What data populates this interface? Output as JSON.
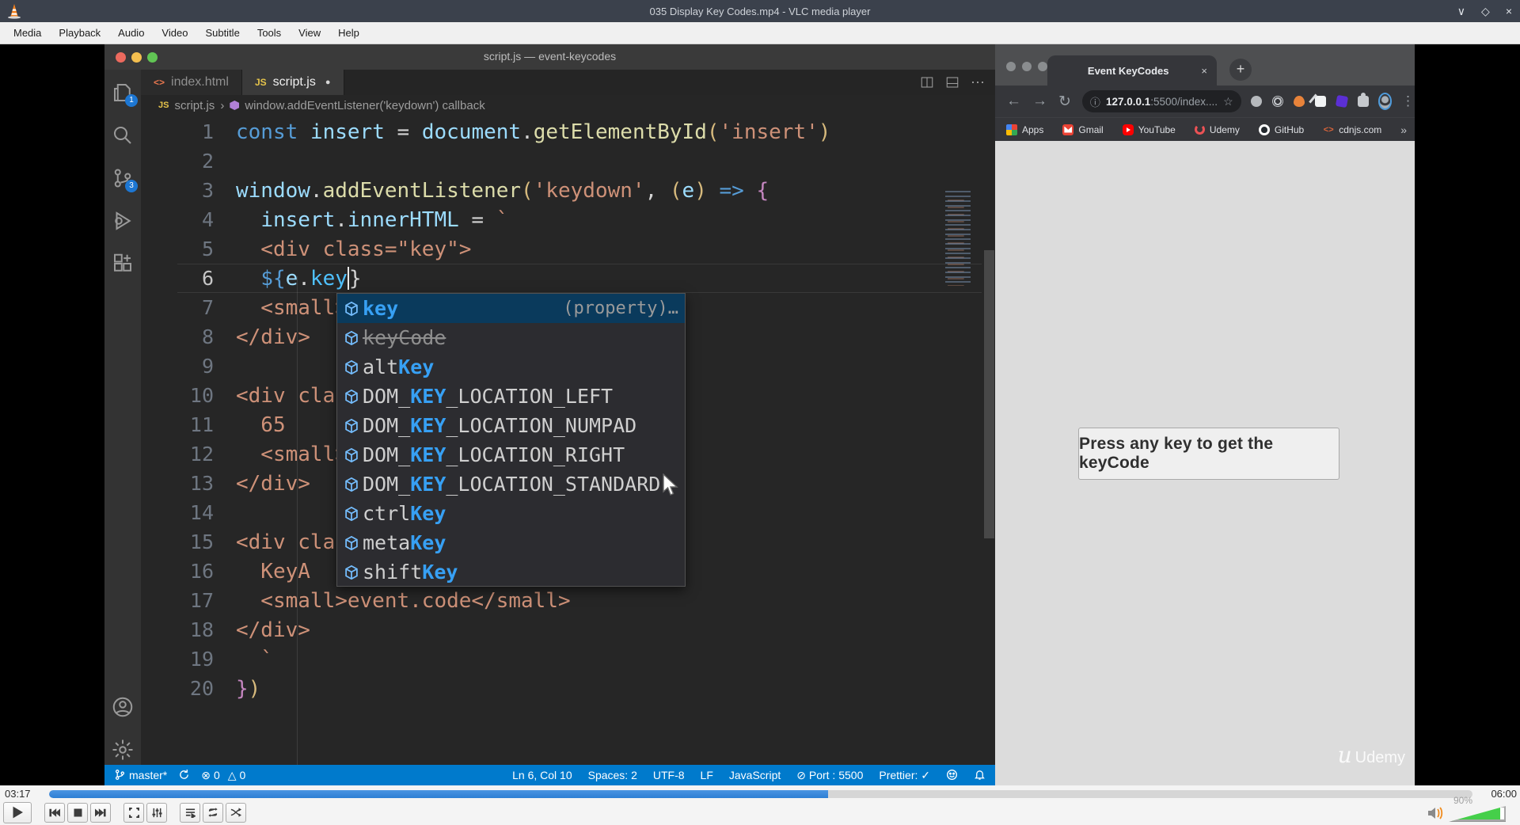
{
  "icons": {
    "min": "∨",
    "max": "◇",
    "close": "×",
    "dot": "●",
    "chev": "›",
    "plus": "+",
    "err": "⊗",
    "warn": "△",
    "port": "⊘",
    "check": "✓",
    "back": "←",
    "fwd": "→",
    "reload": "↻",
    "info": "ⓘ",
    "star": "☆",
    "menu": "⋮",
    "more": "»",
    "code": "<>",
    "ellipsis": "⋯"
  },
  "vlc": {
    "title": "035 Display Key Codes.mp4 - VLC media player",
    "menu": [
      "Media",
      "Playback",
      "Audio",
      "Video",
      "Subtitle",
      "Tools",
      "View",
      "Help"
    ],
    "elapsed": "03:17",
    "total": "06:00",
    "progress_pct": 54.7,
    "volume_label": "90%",
    "volume_pct": 90
  },
  "vscode": {
    "window_title": "script.js — event-keycodes",
    "tabs": [
      {
        "label": "index.html",
        "icon": "<>",
        "active": false,
        "modified": false
      },
      {
        "label": "script.js",
        "icon": "JS",
        "active": true,
        "modified": true
      }
    ],
    "breadcrumb": {
      "file": "script.js",
      "symbol": "window.addEventListener('keydown') callback"
    },
    "badges": {
      "explorer": "1",
      "source_control": "3"
    },
    "code": [
      {
        "n": 1,
        "t": [
          [
            "kw",
            "const"
          ],
          [
            "pl",
            " "
          ],
          [
            "vr",
            "insert"
          ],
          [
            "pl",
            " = "
          ],
          [
            "vr",
            "document"
          ],
          [
            "pl",
            "."
          ],
          [
            "fn",
            "getElementById"
          ],
          [
            "br",
            "("
          ],
          [
            "st",
            "'insert'"
          ],
          [
            "br",
            ")"
          ]
        ]
      },
      {
        "n": 2,
        "t": []
      },
      {
        "n": 3,
        "t": [
          [
            "vr",
            "window"
          ],
          [
            "pl",
            "."
          ],
          [
            "fn",
            "addEventListener"
          ],
          [
            "br",
            "("
          ],
          [
            "st",
            "'keydown'"
          ],
          [
            "pl",
            ", "
          ],
          [
            "br",
            "("
          ],
          [
            "vr",
            "e"
          ],
          [
            "br",
            ")"
          ],
          [
            "pl",
            " "
          ],
          [
            "kw",
            "=>"
          ],
          [
            "pl",
            " "
          ],
          [
            "pu",
            "{"
          ]
        ]
      },
      {
        "n": 4,
        "t": [
          [
            "pl",
            "  "
          ],
          [
            "vr",
            "insert"
          ],
          [
            "pl",
            "."
          ],
          [
            "vr",
            "innerHTML"
          ],
          [
            "pl",
            " = "
          ],
          [
            "st",
            "`"
          ]
        ]
      },
      {
        "n": 5,
        "t": [
          [
            "st",
            "  <div class=\"key\">"
          ]
        ]
      },
      {
        "n": 6,
        "t": [
          [
            "pl",
            "  "
          ],
          [
            "kw",
            "${"
          ],
          [
            "vr",
            "e"
          ],
          [
            "pl",
            "."
          ],
          [
            "pb",
            "key"
          ],
          [
            "caret",
            ""
          ],
          [
            "pl",
            "}"
          ]
        ]
      },
      {
        "n": 7,
        "t": [
          [
            "st",
            "  <small>"
          ]
        ]
      },
      {
        "n": 8,
        "t": [
          [
            "st",
            "</div>"
          ]
        ]
      },
      {
        "n": 9,
        "t": []
      },
      {
        "n": 10,
        "t": [
          [
            "st",
            "<div clas"
          ]
        ]
      },
      {
        "n": 11,
        "t": [
          [
            "st",
            "  65"
          ]
        ]
      },
      {
        "n": 12,
        "t": [
          [
            "st",
            "  <small>"
          ]
        ]
      },
      {
        "n": 13,
        "t": [
          [
            "st",
            "</div>"
          ]
        ]
      },
      {
        "n": 14,
        "t": []
      },
      {
        "n": 15,
        "t": [
          [
            "st",
            "<div clas"
          ]
        ]
      },
      {
        "n": 16,
        "t": [
          [
            "st",
            "  KeyA"
          ]
        ]
      },
      {
        "n": 17,
        "t": [
          [
            "st",
            "  <small>event.code</small>"
          ]
        ]
      },
      {
        "n": 18,
        "t": [
          [
            "st",
            "</div>"
          ]
        ]
      },
      {
        "n": 19,
        "t": [
          [
            "st",
            "  `"
          ]
        ]
      },
      {
        "n": 20,
        "t": [
          [
            "pu",
            "}"
          ],
          [
            "br",
            ")"
          ]
        ]
      }
    ],
    "suggest": [
      {
        "pre": "",
        "match": "key",
        "post": "",
        "selected": true,
        "detail": "(property)…"
      },
      {
        "pre": "keyCode",
        "match": "",
        "post": "",
        "deprecated": true
      },
      {
        "pre": "alt",
        "match": "Key",
        "post": ""
      },
      {
        "pre": "DOM_",
        "match": "KEY",
        "post": "_LOCATION_LEFT"
      },
      {
        "pre": "DOM_",
        "match": "KEY",
        "post": "_LOCATION_NUMPAD"
      },
      {
        "pre": "DOM_",
        "match": "KEY",
        "post": "_LOCATION_RIGHT"
      },
      {
        "pre": "DOM_",
        "match": "KEY",
        "post": "_LOCATION_STANDARD"
      },
      {
        "pre": "ctrl",
        "match": "Key",
        "post": ""
      },
      {
        "pre": "meta",
        "match": "Key",
        "post": ""
      },
      {
        "pre": "shift",
        "match": "Key",
        "post": ""
      }
    ],
    "status": {
      "branch": "master*",
      "errors": "0",
      "warnings": "0",
      "right": [
        {
          "text": "Ln 6, Col 10"
        },
        {
          "text": "Spaces: 2"
        },
        {
          "text": "UTF-8"
        },
        {
          "text": "LF"
        },
        {
          "text": "JavaScript"
        },
        {
          "icon": "port",
          "text": "Port : 5500"
        },
        {
          "text": "Prettier:",
          "icon_after": "check"
        }
      ]
    }
  },
  "browser": {
    "tab_title": "Event KeyCodes",
    "url_host": "127.0.0.1",
    "url_rest": ":5500/index....",
    "bookmarks": [
      "Apps",
      "Gmail",
      "YouTube",
      "Udemy",
      "GitHub",
      "cdnjs.com"
    ],
    "page_text": "Press any key to get the keyCode",
    "watermark_u": "u",
    "watermark": "Udemy"
  }
}
